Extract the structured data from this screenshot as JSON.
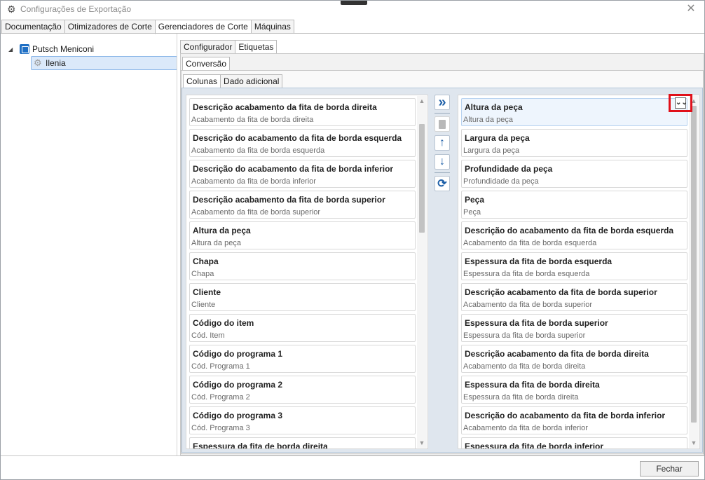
{
  "window": {
    "title": "Configurações de Exportação",
    "close_glyph": "✕",
    "icon": "gear-icon"
  },
  "main_tabs": [
    {
      "label": "Documentação"
    },
    {
      "label": "Otimizadores de Corte"
    },
    {
      "label": "Gerenciadores de Corte"
    },
    {
      "label": "Máquinas"
    }
  ],
  "tree": {
    "root": {
      "label": "Putsch Meniconi",
      "icon": "company-icon"
    },
    "child": {
      "label": "Ilenia",
      "icon": "gear-icon"
    }
  },
  "sub_tabs": [
    {
      "label": "Configurador"
    },
    {
      "label": "Etiquetas"
    }
  ],
  "conv_tabs": [
    {
      "label": "Conversão"
    }
  ],
  "col_tabs": [
    {
      "label": "Colunas"
    },
    {
      "label": "Dado adicional"
    }
  ],
  "available_columns": [
    {
      "title": "Descrição acabamento da fita de borda direita",
      "sub": "Acabamento da fita de borda direita"
    },
    {
      "title": "Descrição do acabamento da fita de borda esquerda",
      "sub": "Acabamento da fita de borda esquerda"
    },
    {
      "title": "Descrição do acabamento da fita de borda inferior",
      "sub": "Acabamento da fita de borda inferior"
    },
    {
      "title": "Descrição acabamento da fita de borda superior",
      "sub": "Acabamento da fita de borda superior"
    },
    {
      "title": "Altura da peça",
      "sub": "Altura da peça"
    },
    {
      "title": "Chapa",
      "sub": "Chapa"
    },
    {
      "title": "Cliente",
      "sub": "Cliente"
    },
    {
      "title": "Código do item",
      "sub": "Cód. Item"
    },
    {
      "title": "Código do programa 1",
      "sub": "Cód. Programa 1"
    },
    {
      "title": "Código do programa 2",
      "sub": "Cód. Programa 2"
    },
    {
      "title": "Código do programa 3",
      "sub": "Cód. Programa 3"
    },
    {
      "title": "Espessura da fita de borda direita",
      "sub": ""
    }
  ],
  "selected_columns": [
    {
      "title": "Altura da peça",
      "sub": "Altura da peça"
    },
    {
      "title": "Largura da peça",
      "sub": "Largura da peça"
    },
    {
      "title": "Profundidade da peça",
      "sub": "Profundidade da peça"
    },
    {
      "title": "Peça",
      "sub": "Peça"
    },
    {
      "title": "Descrição do acabamento da fita de borda esquerda",
      "sub": "Acabamento da fita de borda esquerda"
    },
    {
      "title": "Espessura da fita de borda esquerda",
      "sub": "Espessura da fita de borda esquerda"
    },
    {
      "title": "Descrição acabamento da fita de borda superior",
      "sub": "Acabamento da fita de borda superior"
    },
    {
      "title": "Espessura da fita de borda superior",
      "sub": "Espessura da fita de borda superior"
    },
    {
      "title": "Descrição acabamento da fita de borda direita",
      "sub": "Acabamento da fita de borda direita"
    },
    {
      "title": "Espessura da fita de borda direita",
      "sub": "Espessura da fita de borda direita"
    },
    {
      "title": "Descrição do acabamento da fita de borda inferior",
      "sub": "Acabamento da fita de borda inferior"
    },
    {
      "title": "Espessura da fita de borda inferior",
      "sub": ""
    }
  ],
  "toolbar": {
    "add_all": "»",
    "delete": "🗑",
    "move_up": "↑",
    "move_down": "↓",
    "reset": "⟳"
  },
  "expand_glyph": "¥",
  "footer": {
    "close_label": "Fechar"
  },
  "colors": {
    "accent": "#1f6fc4",
    "highlight": "#e0101a",
    "panel_bg": "#dfe6ee"
  }
}
